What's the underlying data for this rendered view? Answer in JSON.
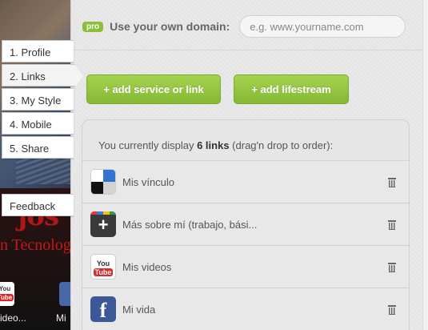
{
  "preview": {
    "big_text": "jos",
    "sub_text": "n Tecnolog",
    "label_left": "ideo...",
    "label_right": "Mi",
    "youtube_label_top": "You",
    "youtube_label_bottom": "Tube"
  },
  "nav": {
    "tabs": [
      {
        "label": "1. Profile"
      },
      {
        "label": "2. Links",
        "active": true
      },
      {
        "label": "3. My Style"
      },
      {
        "label": "4. Mobile"
      },
      {
        "label": "5. Share"
      }
    ],
    "feedback": "Feedback"
  },
  "domain": {
    "badge": "pro",
    "label": "Use your own domain:",
    "placeholder": "e.g. www.yourname.com"
  },
  "buttons": {
    "add_service": "+ add service or link",
    "add_lifestream": "+ add lifestream"
  },
  "links": {
    "header_prefix": "You currently display ",
    "count": "6 links",
    "header_suffix": " (drag'n drop to order):",
    "items": [
      {
        "title": "Mis vínculo",
        "icon": "delicious-icon"
      },
      {
        "title": "Más sobre mí (trabajo, bási...",
        "icon": "google-plus-icon"
      },
      {
        "title": "Mis videos",
        "icon": "youtube-icon"
      },
      {
        "title": "Mi vida",
        "icon": "facebook-icon"
      }
    ]
  },
  "colors": {
    "accent_green": "#8bbf3a",
    "youtube_red": "#d92b2b",
    "facebook_blue": "#3b5998"
  }
}
